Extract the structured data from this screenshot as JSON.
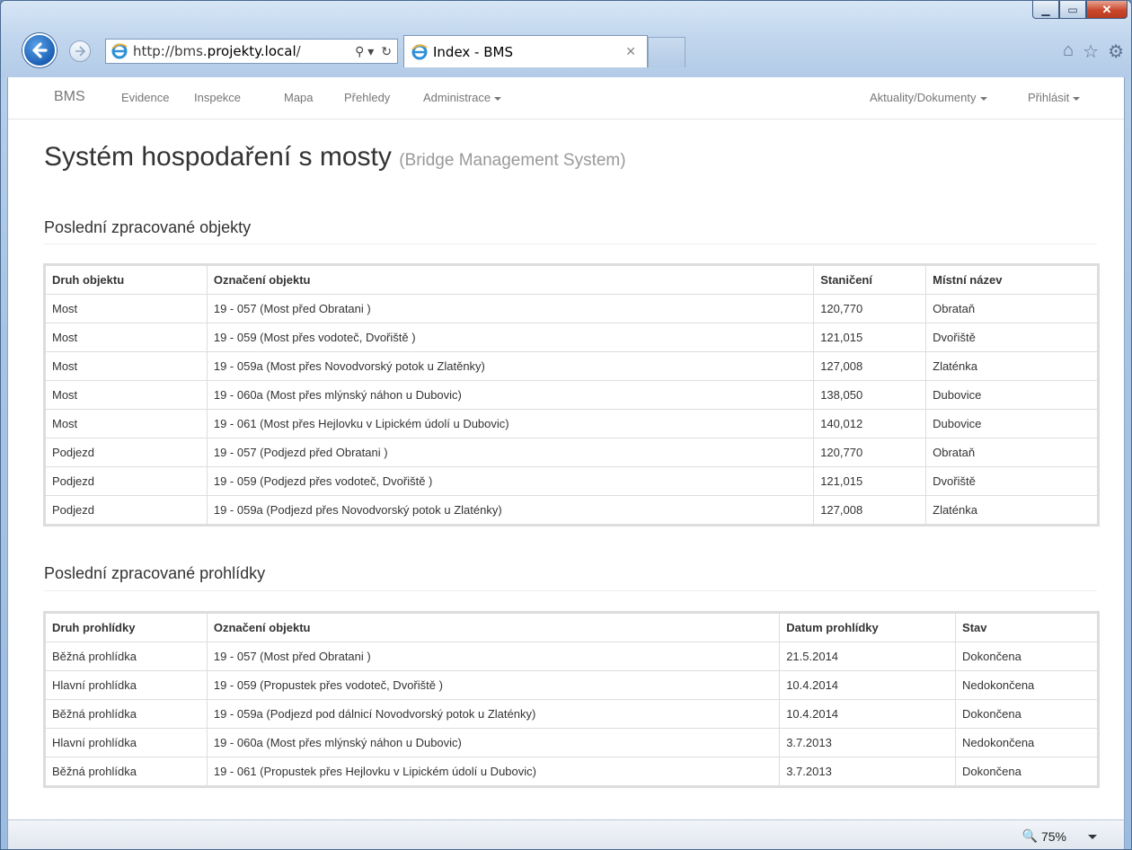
{
  "browser": {
    "url_prefix": "http://bms.",
    "url_host": "projekty.local",
    "url_suffix": "/",
    "tab_title": "Index - BMS",
    "zoom": "75%"
  },
  "nav": {
    "brand": "BMS",
    "items": [
      "Evidence",
      "Inspekce",
      "Mapa",
      "Přehledy",
      "Administrace"
    ],
    "right": [
      "Aktuality/Dokumenty",
      "Přihlásit"
    ]
  },
  "header": {
    "title": "Systém hospodaření s mosty",
    "subtitle": "(Bridge Management System)"
  },
  "objects": {
    "heading": "Poslední zpracované objekty",
    "columns": [
      "Druh objektu",
      "Označení objektu",
      "Staničení",
      "Místní název"
    ],
    "rows": [
      [
        "Most",
        "19 - 057 (Most před Obratani )",
        "120,770",
        "Obrataň"
      ],
      [
        "Most",
        "19 - 059 (Most přes vodoteč, Dvořiště )",
        "121,015",
        "Dvořiště"
      ],
      [
        "Most",
        "19 - 059a (Most přes Novodvorský potok u Zlatěnky)",
        "127,008",
        "Zlaténka"
      ],
      [
        "Most",
        "19 - 060a (Most přes mlýnský náhon u Dubovic)",
        "138,050",
        "Dubovice"
      ],
      [
        "Most",
        "19 - 061 (Most přes Hejlovku v Lipickém údolí u Dubovic)",
        "140,012",
        "Dubovice"
      ],
      [
        "Podjezd",
        "19 - 057 (Podjezd před Obratani )",
        "120,770",
        "Obrataň"
      ],
      [
        "Podjezd",
        "19 - 059 (Podjezd přes vodoteč, Dvořiště )",
        "121,015",
        "Dvořiště"
      ],
      [
        "Podjezd",
        "19 - 059a (Podjezd přes Novodvorský potok u Zlaténky)",
        "127,008",
        "Zlaténka"
      ]
    ]
  },
  "inspections": {
    "heading": "Poslední zpracované prohlídky",
    "columns": [
      "Druh prohlídky",
      "Označení objektu",
      "Datum prohlídky",
      "Stav"
    ],
    "rows": [
      [
        "Běžná prohlídka",
        "19 - 057 (Most před Obratani )",
        "21.5.2014",
        "Dokončena"
      ],
      [
        "Hlavní prohlídka",
        "19 - 059 (Propustek přes vodoteč, Dvořiště )",
        "10.4.2014",
        "Nedokončena"
      ],
      [
        "Běžná prohlídka",
        "19 - 059a (Podjezd pod dálnicí Novodvorský potok u Zlaténky)",
        "10.4.2014",
        "Dokončena"
      ],
      [
        "Hlavní prohlídka",
        "19 - 060a (Most přes mlýnský náhon u Dubovic)",
        "3.7.2013",
        "Nedokončena"
      ],
      [
        "Běžná prohlídka",
        "19 - 061 (Propustek přes Hejlovku v Lipickém údolí u Dubovic)",
        "3.7.2013",
        "Dokončena"
      ]
    ]
  }
}
